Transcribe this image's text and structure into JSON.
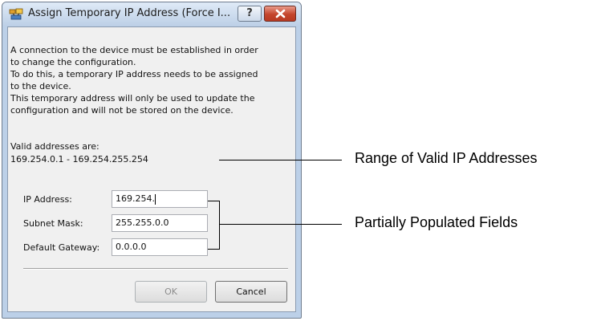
{
  "dialog": {
    "title": "Assign Temporary IP Address (Force I...",
    "help_label": "?",
    "message_lines": [
      "A connection to the device must be established in order",
      "to change the configuration.",
      "To do this, a temporary IP address needs to be assigned",
      "to the device.",
      "This temporary address will only be used to update the",
      "configuration and will not be stored on the device."
    ],
    "valid_label": "Valid addresses are:",
    "valid_range": "169.254.0.1 - 169.254.255.254",
    "fields": [
      {
        "label": "IP Address:",
        "value": "169.254."
      },
      {
        "label": "Subnet Mask:",
        "value": "255.255.0.0"
      },
      {
        "label": "Default Gateway:",
        "value": "0.0.0.0"
      }
    ],
    "ok_label": "OK",
    "cancel_label": "Cancel"
  },
  "annotations": {
    "range_label": "Range of Valid IP Addresses",
    "fields_label": "Partially Populated Fields"
  },
  "icons": [
    "network-app-icon",
    "help-icon",
    "close-icon"
  ]
}
